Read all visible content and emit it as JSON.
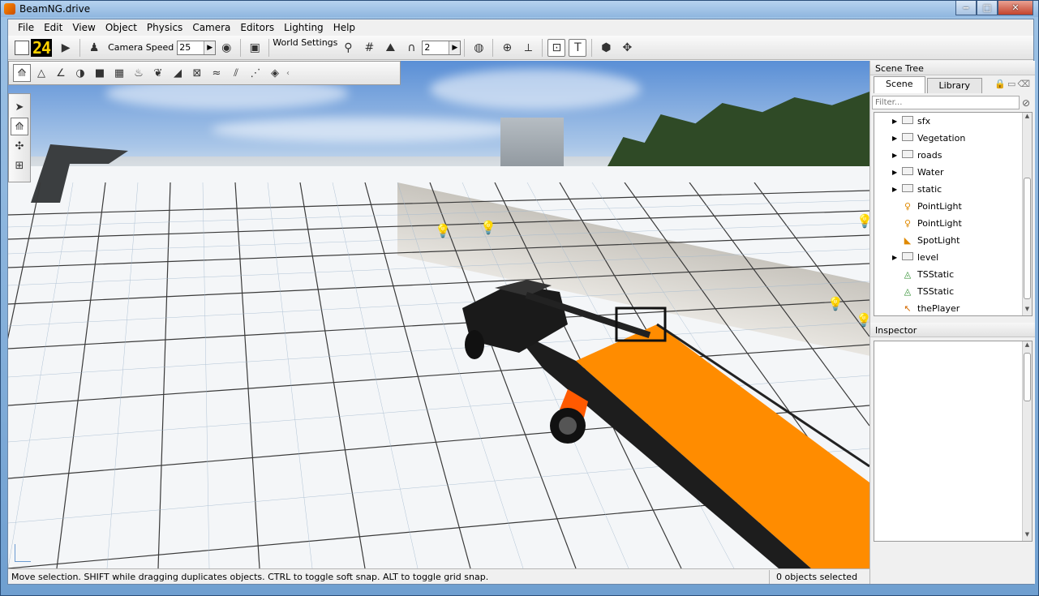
{
  "window": {
    "title": "BeamNG.drive"
  },
  "menu": [
    "File",
    "Edit",
    "View",
    "Object",
    "Physics",
    "Camera",
    "Editors",
    "Lighting",
    "Help"
  ],
  "toolbar": {
    "fps": "24",
    "camera_speed_label": "Camera Speed",
    "camera_speed_value": "25",
    "world_settings_label": "World Settings",
    "snap_value": "2"
  },
  "scene_tree": {
    "header": "Scene Tree",
    "tabs": [
      "Scene",
      "Library"
    ],
    "filter_placeholder": "Filter...",
    "items": [
      {
        "label": "sfx",
        "icon": "folder-icon",
        "expandable": true
      },
      {
        "label": "Vegetation",
        "icon": "folder-icon",
        "expandable": true
      },
      {
        "label": "roads",
        "icon": "folder-icon",
        "expandable": true
      },
      {
        "label": "Water",
        "icon": "folder-icon",
        "expandable": true
      },
      {
        "label": "static",
        "icon": "folder-icon",
        "expandable": true
      },
      {
        "label": "PointLight",
        "icon": "point-light-icon",
        "expandable": false
      },
      {
        "label": "PointLight",
        "icon": "point-light-icon",
        "expandable": false
      },
      {
        "label": "SpotLight",
        "icon": "spot-light-icon",
        "expandable": false
      },
      {
        "label": "level",
        "icon": "folder-icon",
        "expandable": true
      },
      {
        "label": "TSStatic",
        "icon": "tsstatic-icon",
        "expandable": false
      },
      {
        "label": "TSStatic",
        "icon": "tsstatic-icon",
        "expandable": false
      },
      {
        "label": "thePlayer",
        "icon": "player-icon",
        "expandable": false
      }
    ]
  },
  "inspector": {
    "header": "Inspector"
  },
  "status": {
    "hint": "Move selection.  SHIFT while dragging duplicates objects.  CTRL to toggle soft snap.  ALT to toggle grid snap.",
    "selection": "0 objects selected"
  },
  "colors": {
    "ramp": "#ff8c00",
    "fps_digits": "#ffd200"
  }
}
